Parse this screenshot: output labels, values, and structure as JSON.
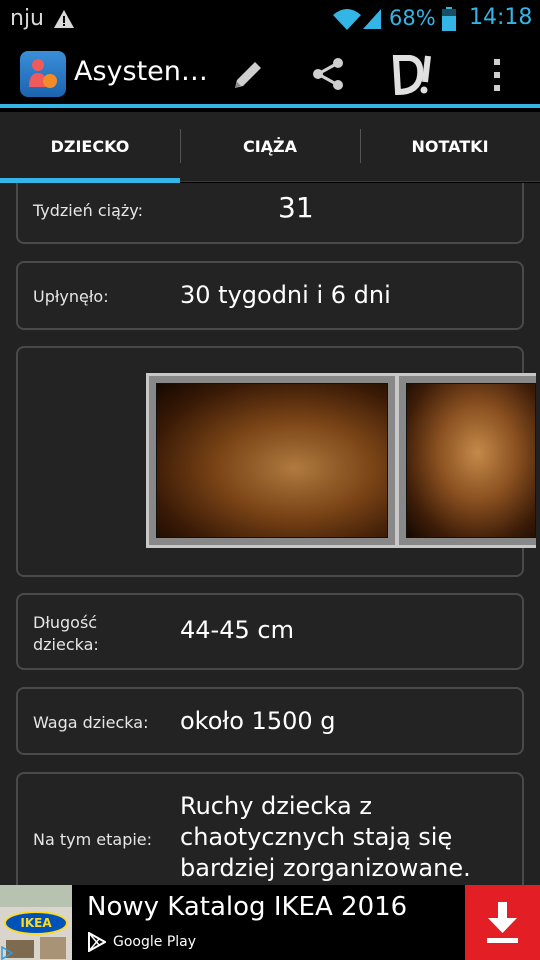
{
  "status_bar": {
    "carrier": "nju",
    "battery": "68%",
    "time": "14:18"
  },
  "action_bar": {
    "title": "Asysten…",
    "icons": [
      "app-icon",
      "pencil-icon",
      "share-icon",
      "di-icon",
      "overflow-menu-icon"
    ]
  },
  "tabs": [
    {
      "label": "DZIECKO",
      "selected": true
    },
    {
      "label": "CIĄŻA",
      "selected": false
    },
    {
      "label": "NOTATKI",
      "selected": false
    }
  ],
  "rows": [
    {
      "label": "Tydzień ciąży:",
      "value": "31"
    },
    {
      "label": "Upłynęło:",
      "value": "30 tygodni i 6 dni"
    },
    {
      "label": "Długość dziecka:",
      "value": "44-45 cm"
    },
    {
      "label": "Waga dziecka:",
      "value": "około 1500 g"
    },
    {
      "label": "Na tym etapie:",
      "value": "Ruchy dziecka z chaotycznych stają się bardziej zorganizowane."
    }
  ],
  "gallery": {
    "image_count_visible": 2
  },
  "ad": {
    "brand": "IKEA",
    "title": "Nowy Katalog IKEA 2016",
    "store": "Google Play"
  },
  "colors": {
    "accent": "#33b5e5",
    "background": "#222222",
    "card_border": "#4a4a4a",
    "ad_button": "#e31e24"
  }
}
